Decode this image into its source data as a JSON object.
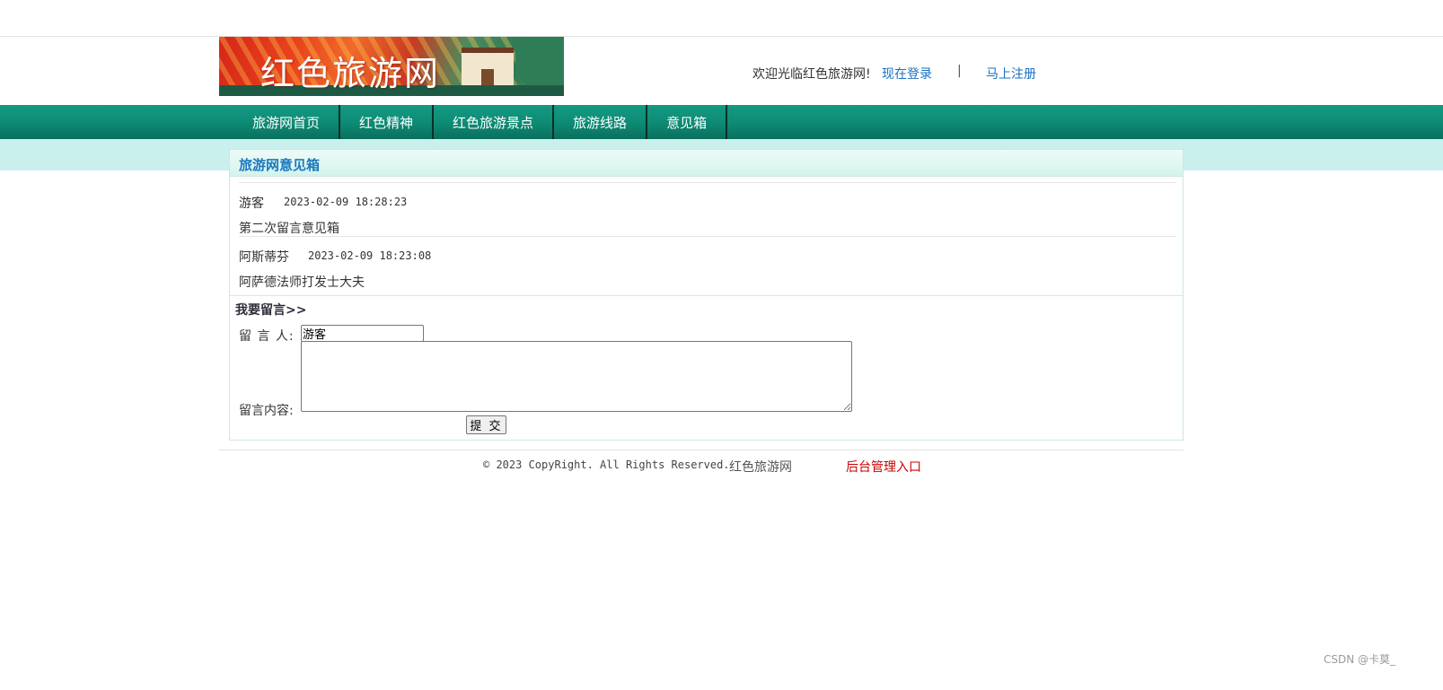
{
  "header": {
    "logo_text": "红色旅游网",
    "welcome_text": "欢迎光临红色旅游网!",
    "login_link": "现在登录",
    "separator": "|",
    "register_link": "马上注册"
  },
  "nav": {
    "items": [
      {
        "label": "旅游网首页"
      },
      {
        "label": "红色精神"
      },
      {
        "label": "红色旅游景点"
      },
      {
        "label": "旅游线路"
      },
      {
        "label": "意见箱"
      }
    ]
  },
  "main": {
    "title": "旅游网意见箱",
    "messages": [
      {
        "author": "游客",
        "time": "2023-02-09 18:28:23",
        "content": "第二次留言意见箱"
      },
      {
        "author": "阿斯蒂芬",
        "time": "2023-02-09 18:23:08",
        "content": "阿萨德法师打发士大夫"
      }
    ]
  },
  "form": {
    "heading": "我要留言>>",
    "author_label": "留 言 人:",
    "author_value": "游客",
    "content_label": "留言内容:",
    "content_value": "",
    "submit_label": "提 交"
  },
  "footer": {
    "copyright": "© 2023 CopyRight. All Rights Reserved.",
    "site_name": "红色旅游网",
    "admin_link": "后台管理入口"
  },
  "watermark": "CSDN @卡莫_",
  "colors": {
    "nav_bg": "#0d8a74",
    "band_bg": "#c9f0ec",
    "link": "#1a6fc0",
    "admin_link": "#cc0000",
    "title": "#1b78c0"
  }
}
